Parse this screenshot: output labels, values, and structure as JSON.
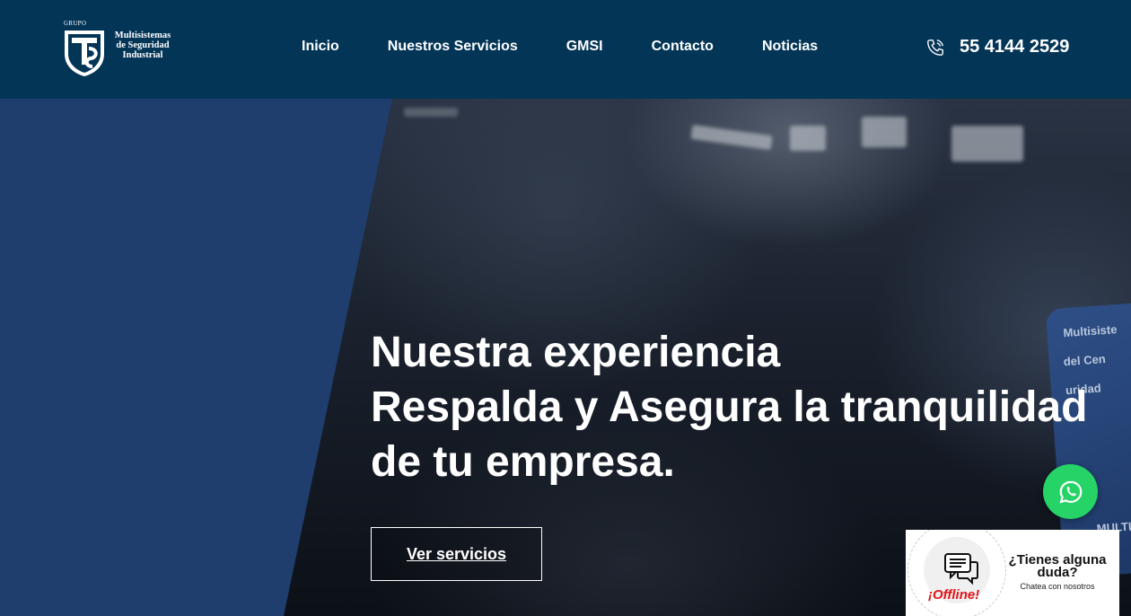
{
  "logo": {
    "grupo": "GRUPO",
    "line1": "Multisistemas",
    "line2": "de Seguridad",
    "line3": "Industrial"
  },
  "nav": {
    "items": [
      {
        "label": "Inicio"
      },
      {
        "label": "Nuestros Servicios"
      },
      {
        "label": "GMSI"
      },
      {
        "label": "Contacto"
      },
      {
        "label": "Noticias"
      }
    ]
  },
  "phone": {
    "number": "55 4144 2529",
    "icon": "phone-icon"
  },
  "hero": {
    "line1": "Nuestra experiencia",
    "line2_bold": "Respalda y Asegura",
    "line2_rest": " la tranquilidad",
    "line3": "de tu empresa.",
    "cta_label": "Ver servicios",
    "panel_color": "#1f3e6d"
  },
  "chat": {
    "status": "¡Offline!",
    "question": "¿Tienes alguna duda?",
    "subtitle": "Chatea con nosotros"
  },
  "colors": {
    "header_bg": "#033557",
    "whatsapp": "#25d366",
    "offline": "#e2141b"
  }
}
